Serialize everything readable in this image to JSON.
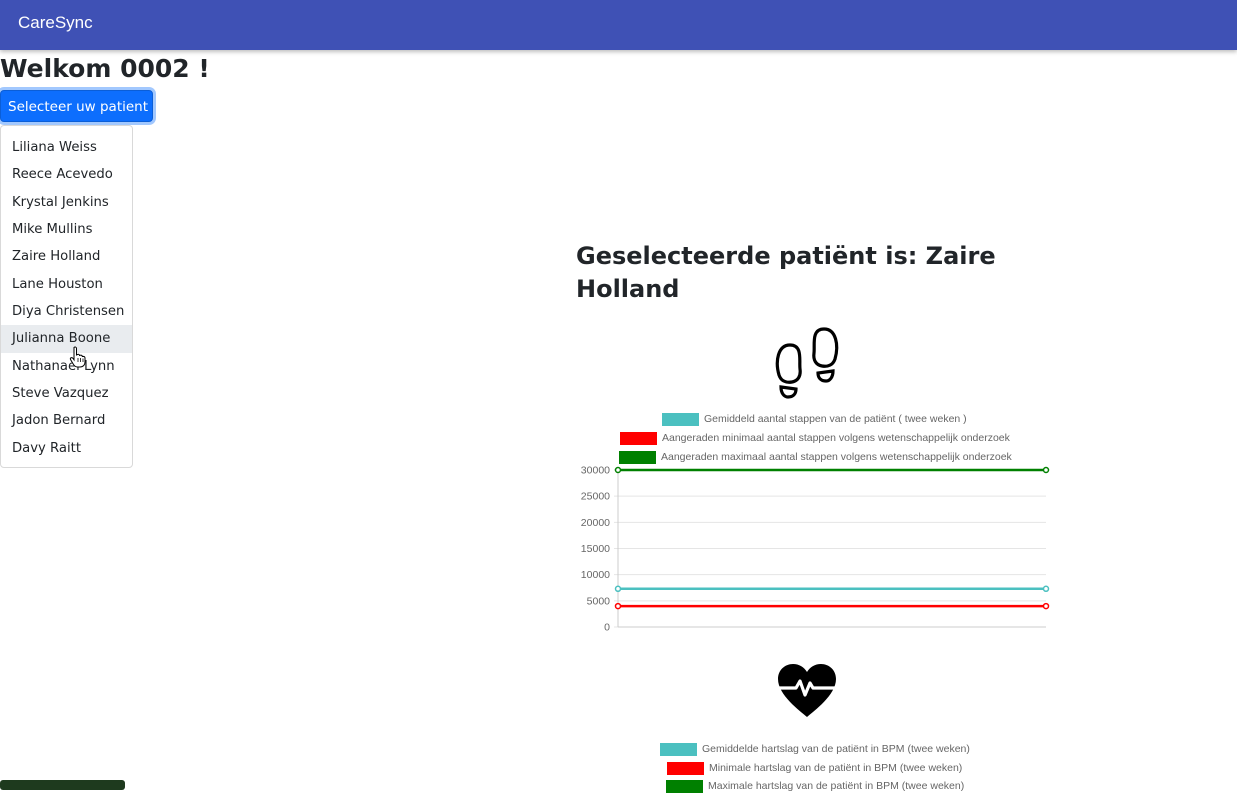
{
  "navbar": {
    "brand": "CareSync"
  },
  "welcome": {
    "text": "Welkom 0002 !"
  },
  "patient_select": {
    "button_label": "Selecteer uw patient",
    "items": [
      "Liliana Weiss",
      "Reece Acevedo",
      "Krystal Jenkins",
      "Mike Mullins",
      "Zaire Holland",
      "Lane Houston",
      "Diya Christensen",
      "Julianna Boone",
      "Nathanael Lynn",
      "Steve Vazquez",
      "Jadon Bernard",
      "Davy Raitt"
    ],
    "hovered_item": "Julianna Boone"
  },
  "selected": {
    "title": "Geselecteerde patiënt is: Zaire Holland"
  },
  "icons": {
    "steps": "footprints-icon",
    "heart": "heartbeat-icon",
    "cursor": "hand-pointer-icon"
  },
  "colors": {
    "navbar": "#3f51b5",
    "button": "#0d6efd",
    "teal": "#4bc0c0",
    "red": "#ff0000",
    "green": "#008000"
  },
  "chart_data": [
    {
      "type": "line",
      "title": "",
      "ylim": [
        0,
        30000
      ],
      "y_ticks": [
        "0",
        "5000",
        "10000",
        "15000",
        "20000",
        "25000",
        "30000"
      ],
      "x": [
        0,
        1
      ],
      "legend_position": "top",
      "grid": true,
      "series": [
        {
          "name": "Gemiddeld aantal stappen van de patiënt ( twee weken )",
          "color": "#4bc0c0",
          "values": [
            7300,
            7300
          ]
        },
        {
          "name": "Aangeraden minimaal aantal stappen volgens wetenschappelijk onderzoek",
          "color": "#ff0000",
          "values": [
            4000,
            4000
          ]
        },
        {
          "name": "Aangeraden maximaal aantal stappen volgens wetenschappelijk onderzoek",
          "color": "#008000",
          "values": [
            30000,
            30000
          ]
        }
      ]
    },
    {
      "type": "line",
      "title": "",
      "legend_position": "top",
      "series": [
        {
          "name": "Gemiddelde hartslag van de patiënt in BPM (twee weken)",
          "color": "#4bc0c0"
        },
        {
          "name": "Minimale hartslag van de patiënt in BPM (twee weken)",
          "color": "#ff0000"
        },
        {
          "name": "Maximale hartslag van de patiënt in BPM (twee weken)",
          "color": "#008000"
        }
      ]
    }
  ]
}
